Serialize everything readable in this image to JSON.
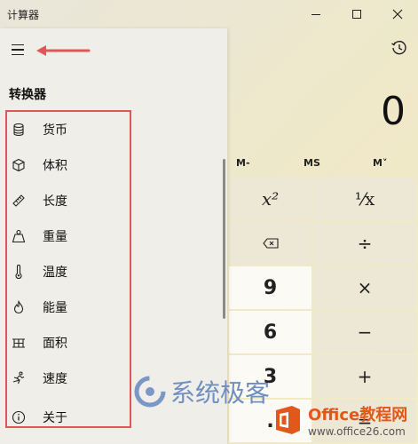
{
  "window": {
    "title": "计算器"
  },
  "calculator": {
    "display": "0",
    "memory": [
      "M-",
      "MS",
      "M˅"
    ],
    "keys": {
      "square": "x²",
      "reciprocal": "¹⁄x",
      "backspace_icon": "backspace-icon",
      "divide": "÷",
      "nine": "9",
      "multiply": "×",
      "six": "6",
      "minus": "−",
      "three": "3",
      "plus": "+",
      "decimal": ".",
      "equals": "="
    }
  },
  "nav": {
    "section_title": "转换器",
    "items": [
      {
        "label": "货币",
        "icon": "currency-icon"
      },
      {
        "label": "体积",
        "icon": "volume-icon"
      },
      {
        "label": "长度",
        "icon": "length-icon"
      },
      {
        "label": "重量",
        "icon": "weight-icon"
      },
      {
        "label": "温度",
        "icon": "temperature-icon"
      },
      {
        "label": "能量",
        "icon": "energy-icon"
      },
      {
        "label": "面积",
        "icon": "area-icon"
      },
      {
        "label": "速度",
        "icon": "speed-icon"
      }
    ],
    "about": {
      "label": "关于",
      "icon": "info-icon"
    }
  },
  "colors": {
    "annotation_red": "#e05555",
    "nav_bg": "#efeee9"
  },
  "watermarks": {
    "xitong": "系统极客",
    "office_title": "Office教程网",
    "office_url": "www.office26.com"
  }
}
